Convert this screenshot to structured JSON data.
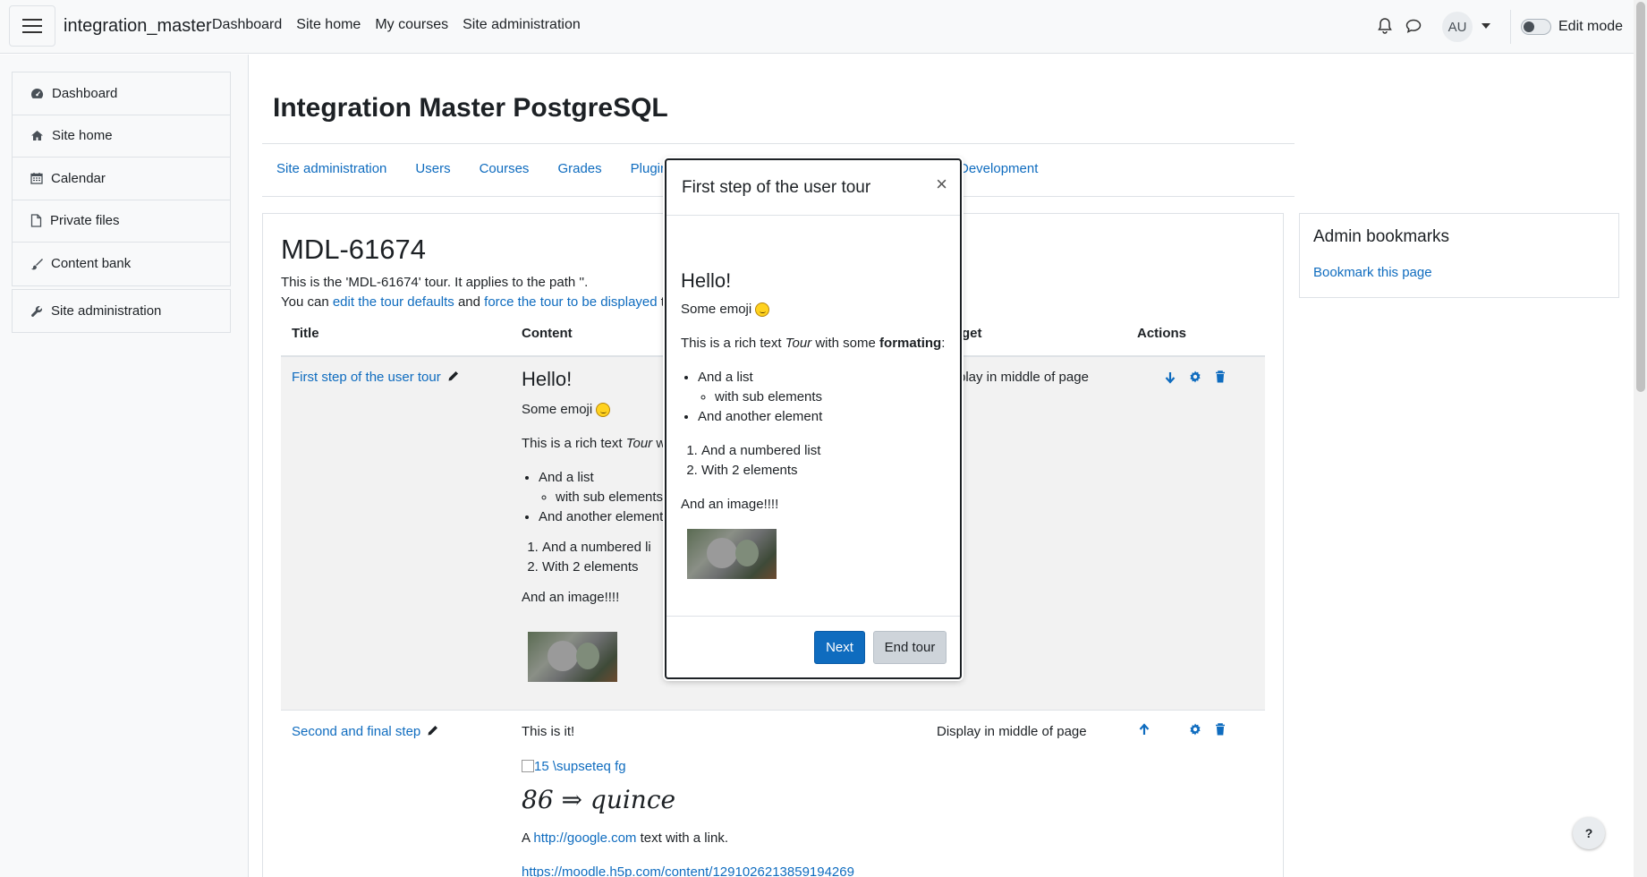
{
  "navbar": {
    "brand": "integration_master",
    "links": [
      "Dashboard",
      "Site home",
      "My courses",
      "Site administration"
    ],
    "avatar_initials": "AU",
    "edit_mode_label": "Edit mode",
    "edit_mode_on": false
  },
  "drawer": {
    "items": [
      "Dashboard",
      "Site home",
      "Calendar",
      "Private files",
      "Content bank"
    ],
    "admin_item": "Site administration"
  },
  "page": {
    "title": "Integration Master PostgreSQL",
    "secondary_nav": [
      "Site administration",
      "Users",
      "Courses",
      "Grades",
      "Plugins",
      "Development"
    ]
  },
  "tour": {
    "title": "MDL-61674",
    "desc_line1": "This is the 'MDL-61674' tour. It applies to the path ''.",
    "desc_prefix": "You can",
    "link_edit_defaults": "edit the tour defaults",
    "desc_and": "and",
    "link_force": "force the tour to be displayed",
    "desc_suffix": "t"
  },
  "table": {
    "headers": {
      "title": "Title",
      "content": "Content",
      "target": "get",
      "actions": "Actions"
    },
    "rows": [
      {
        "title": "First step of the user tour",
        "content_heading": "Hello!",
        "content_emoji_text": "Some emoji",
        "content_rich_prefix": "This is a rich text",
        "content_rich_italic": "Tour",
        "content_rich_trunc": "w",
        "list_item1": "And a list",
        "list_sub": "with sub elements",
        "list_item2": "And another element",
        "ol_item1": "And a numbered li",
        "ol_item2": "With 2 elements",
        "image_text": "And an image!!!!",
        "target": "play in middle of page"
      },
      {
        "title": "Second and final step",
        "content_line1": "This is it!",
        "broken_img": "15 \\supseteq fg",
        "math": "86 ⇒ quince",
        "link_text_prefix": "A",
        "link_url": "http://google.com",
        "link_text_suffix": "text with a link.",
        "h5p_link": "https://moodle.h5p.com/content/1291026213859194269",
        "target": "Display in middle of page"
      }
    ]
  },
  "modal": {
    "title": "First step of the user tour",
    "close": "×",
    "heading": "Hello!",
    "emoji_text": "Some emoji",
    "rich_prefix": "This is a rich text",
    "rich_italic": "Tour",
    "rich_mid": "with some",
    "rich_bold": "formating",
    "rich_end": ":",
    "list_item1": "And a list",
    "list_sub": "with sub elements",
    "list_item2": "And another element",
    "ol_item1": "And a numbered list",
    "ol_item2": "With 2 elements",
    "image_text": "And an image!!!!",
    "next_button": "Next",
    "end_button": "End tour"
  },
  "bookmarks": {
    "title": "Admin bookmarks",
    "link": "Bookmark this page"
  },
  "help_button": "?",
  "colors": {
    "link": "#0f6cbf",
    "primary_button": "#0f6cbf",
    "secondary_button": "#ced4da"
  }
}
